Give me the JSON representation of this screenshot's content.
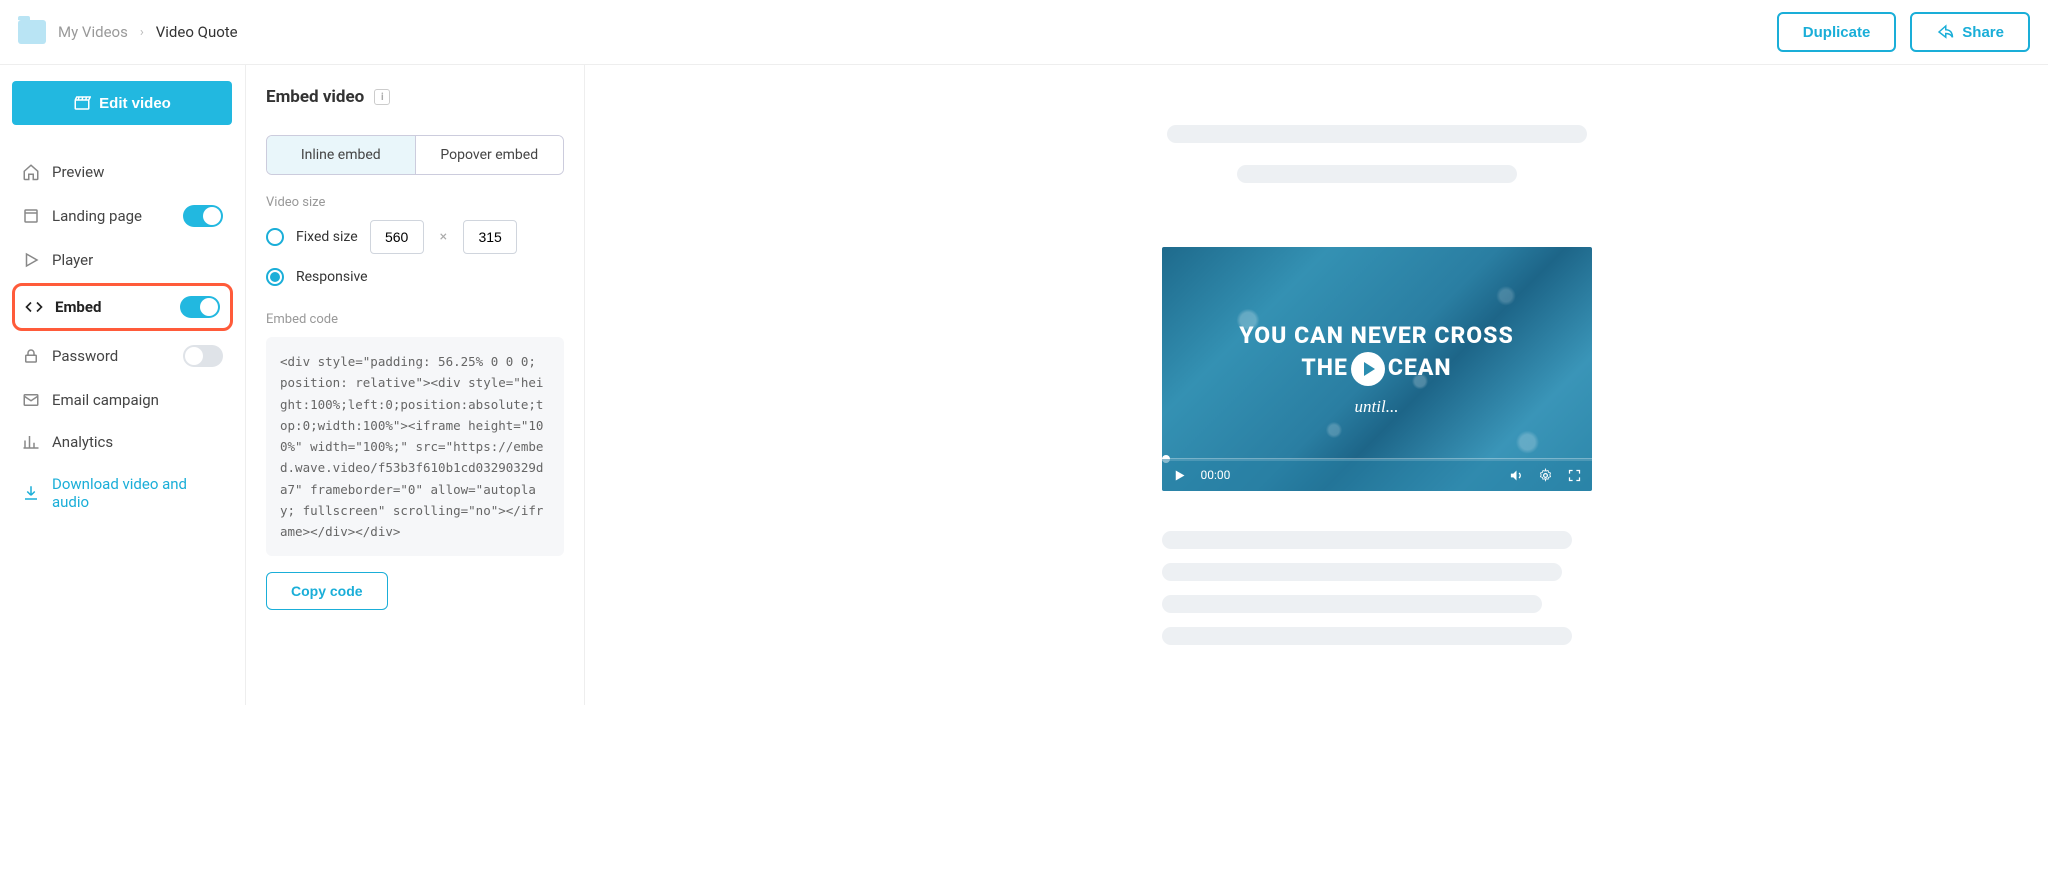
{
  "breadcrumb": {
    "parent": "My Videos",
    "current": "Video Quote"
  },
  "top_actions": {
    "duplicate": "Duplicate",
    "share": "Share"
  },
  "sidebar": {
    "edit_button": "Edit video",
    "items": {
      "preview": "Preview",
      "landing_page": "Landing page",
      "player": "Player",
      "embed": "Embed",
      "password": "Password",
      "email_campaign": "Email campaign",
      "analytics": "Analytics",
      "download": "Download video and audio"
    },
    "toggles": {
      "landing_page": true,
      "embed": true,
      "password": false
    }
  },
  "embed_panel": {
    "title": "Embed video",
    "tabs": {
      "inline": "Inline embed",
      "popover": "Popover embed",
      "active": "inline"
    },
    "video_size_label": "Video size",
    "fixed_size_label": "Fixed size",
    "fixed_width": "560",
    "fixed_height": "315",
    "responsive_label": "Responsive",
    "size_mode": "responsive",
    "embed_code_label": "Embed code",
    "embed_code": "<div style=\"padding: 56.25% 0 0 0; position: relative\"><div style=\"height:100%;left:0;position:absolute;top:0;width:100%\"><iframe height=\"100%\" width=\"100%;\" src=\"https://embed.wave.video/f53b3f610b1cd03290329da7\" frameborder=\"0\" allow=\"autoplay; fullscreen\" scrolling=\"no\"></iframe></div></div>",
    "copy_button": "Copy code"
  },
  "video_preview": {
    "line1": "YOU CAN NEVER CROSS",
    "line2a": "THE",
    "line2b": "CEAN",
    "subtitle": "until...",
    "time": "00:00"
  }
}
